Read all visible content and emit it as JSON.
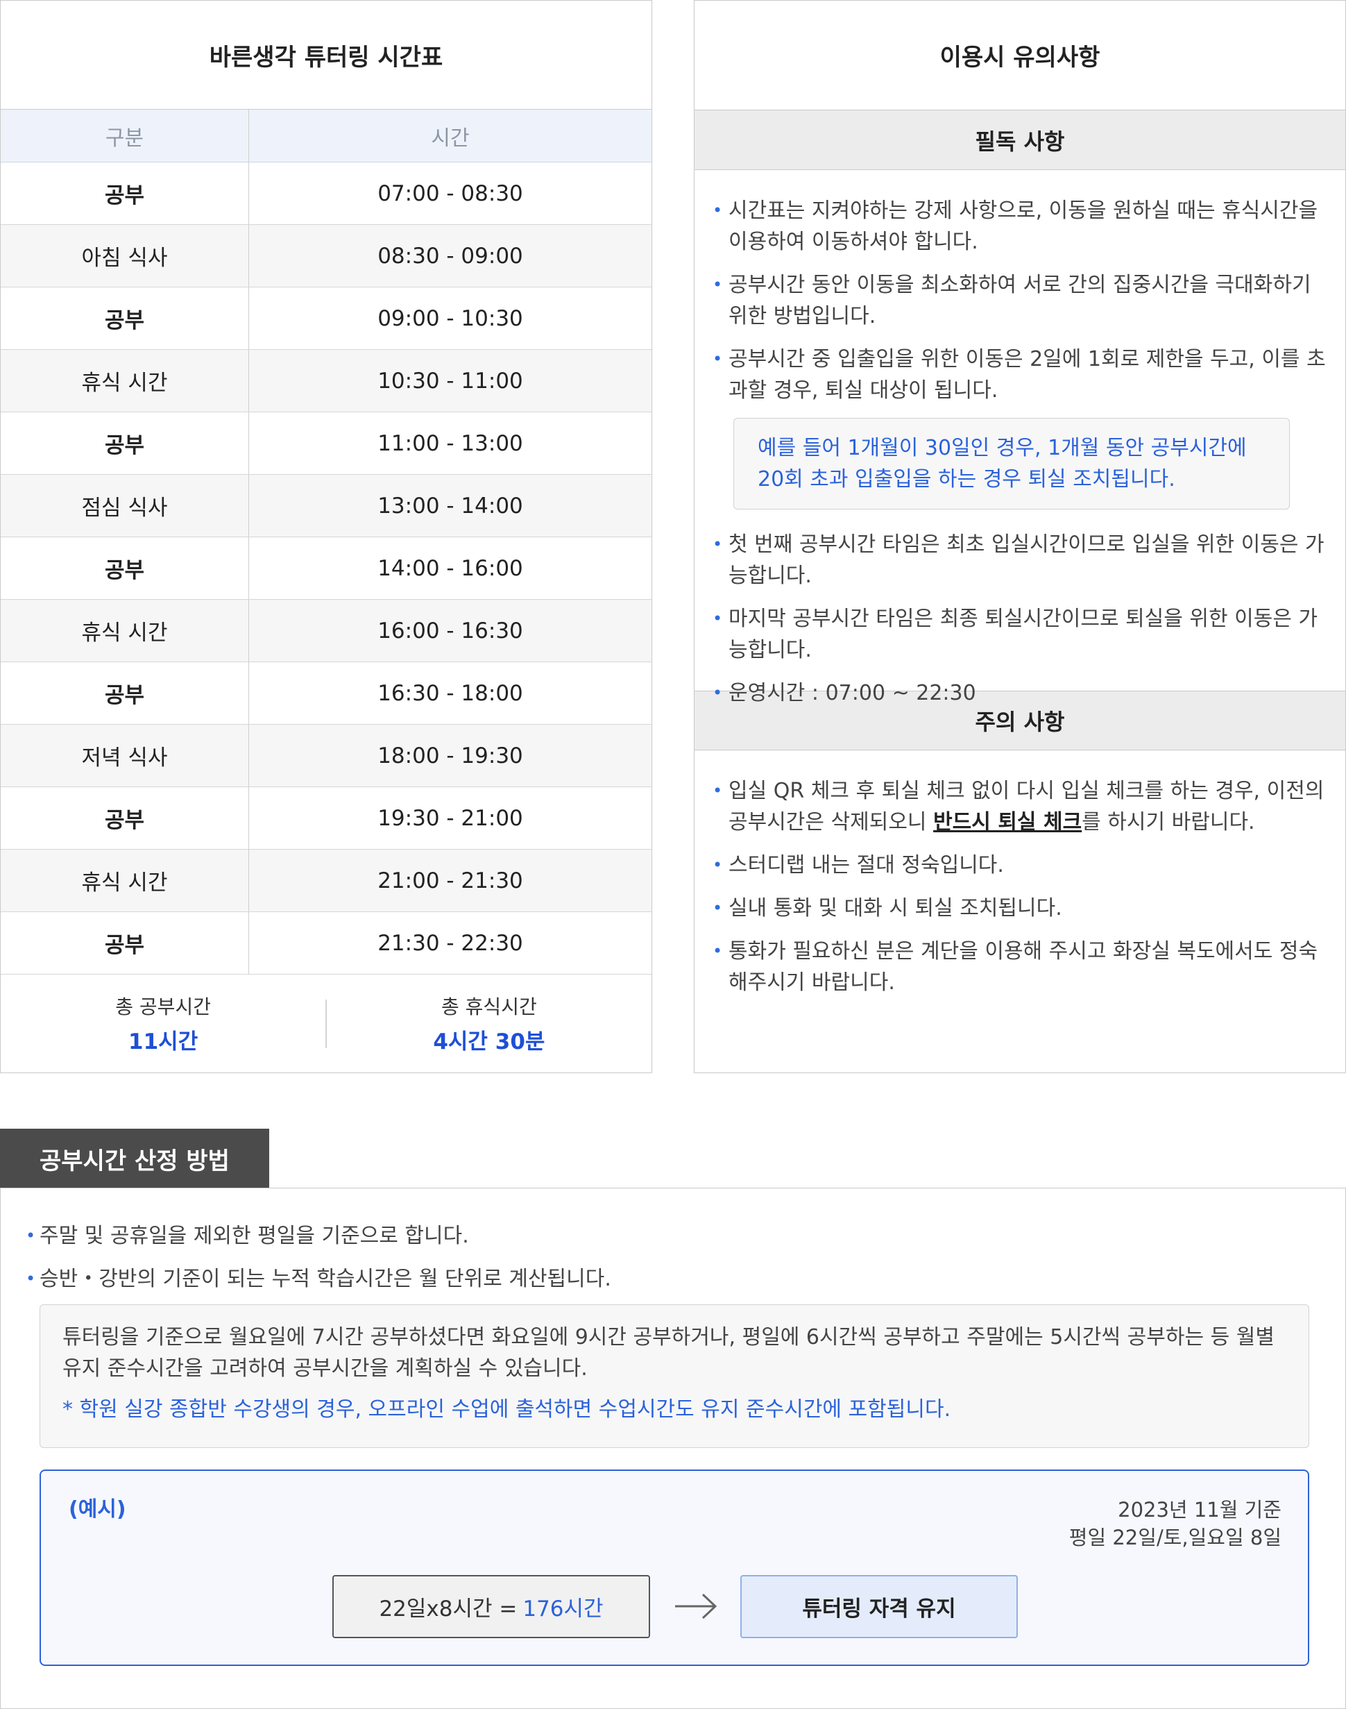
{
  "schedule": {
    "title": "바른생각 튜터링 시간표",
    "headers": {
      "category": "구분",
      "time": "시간"
    },
    "rows": [
      {
        "label": "공부",
        "time": "07:00 - 08:30",
        "study": true
      },
      {
        "label": "아침 식사",
        "time": "08:30 - 09:00",
        "study": false
      },
      {
        "label": "공부",
        "time": "09:00 - 10:30",
        "study": true
      },
      {
        "label": "휴식 시간",
        "time": "10:30 - 11:00",
        "study": false
      },
      {
        "label": "공부",
        "time": "11:00 - 13:00",
        "study": true
      },
      {
        "label": "점심 식사",
        "time": "13:00 - 14:00",
        "study": false
      },
      {
        "label": "공부",
        "time": "14:00 - 16:00",
        "study": true
      },
      {
        "label": "휴식 시간",
        "time": "16:00 - 16:30",
        "study": false
      },
      {
        "label": "공부",
        "time": "16:30 - 18:00",
        "study": true
      },
      {
        "label": "저녁 식사",
        "time": "18:00 - 19:30",
        "study": false
      },
      {
        "label": "공부",
        "time": "19:30 - 21:00",
        "study": true
      },
      {
        "label": "휴식 시간",
        "time": "21:00 - 21:30",
        "study": false
      },
      {
        "label": "공부",
        "time": "21:30 - 22:30",
        "study": true
      }
    ],
    "totals": {
      "study_label": "총 공부시간",
      "study_value": "11시간",
      "rest_label": "총 휴식시간",
      "rest_value": "4시간 30분"
    }
  },
  "notice": {
    "title": "이용시 유의사항",
    "required": {
      "heading": "필독 사항",
      "items": [
        "시간표는 지켜야하는 강제 사항으로, 이동을 원하실 때는 휴식시간을 이용하여 이동하셔야 합니다.",
        "공부시간 동안 이동을 최소화하여 서로 간의 집중시간을 극대화하기 위한 방법입니다.",
        "공부시간 중 입출입을 위한 이동은 2일에 1회로 제한을 두고, 이를 초과할 경우, 퇴실 대상이 됩니다."
      ],
      "highlight": "예를 들어 1개월이 30일인 경우, 1개월 동안 공부시간에 20회 초과 입출입을 하는 경우 퇴실 조치됩니다.",
      "items_after": [
        "첫 번째 공부시간 타임은 최초 입실시간이므로 입실을 위한 이동은 가능합니다.",
        "마지막 공부시간 타임은 최종 퇴실시간이므로 퇴실을 위한 이동은 가능합니다.",
        "운영시간 : 07:00 ~ 22:30"
      ]
    },
    "caution": {
      "heading": "주의 사항",
      "item1_pre": "입실 QR 체크 후 퇴실 체크 없이 다시 입실 체크를 하는 경우, 이전의 공부시간은 삭제되오니 ",
      "item1_emph": "반드시 퇴실 체크",
      "item1_post": "를 하시기 바랍니다.",
      "items": [
        "스터디랩 내는 절대 정숙입니다.",
        "실내 통화 및 대화 시 퇴실 조치됩니다.",
        "통화가 필요하신 분은 계단을 이용해 주시고 화장실 복도에서도 정숙해주시기 바랍니다."
      ]
    }
  },
  "method": {
    "tab": "공부시간 산정 방법",
    "items": [
      "주말 및 공휴일을 제외한 평일을 기준으로 합니다.",
      "승반・강반의 기준이 되는 누적 학습시간은 월 단위로 계산됩니다."
    ],
    "info": "튜터링을 기준으로 월요일에 7시간 공부하셨다면 화요일에 9시간 공부하거나, 평일에 6시간씩 공부하고 주말에는 5시간씩 공부하는 등  월별 유지 준수시간을 고려하여 공부시간을 계획하실 수 있습니다.",
    "info_note": "* 학원 실강 종합반 수강생의 경우, 오프라인 수업에 출석하면  수업시간도 유지 준수시간에 포함됩니다.",
    "example": {
      "tag": "(예시)",
      "date_line1": "2023년 11월 기준",
      "date_line2": "평일 22일/토,일요일 8일",
      "calc_prefix": "22일x8시간 =",
      "calc_result": "176시간",
      "result": "튜터링 자격 유지"
    }
  }
}
